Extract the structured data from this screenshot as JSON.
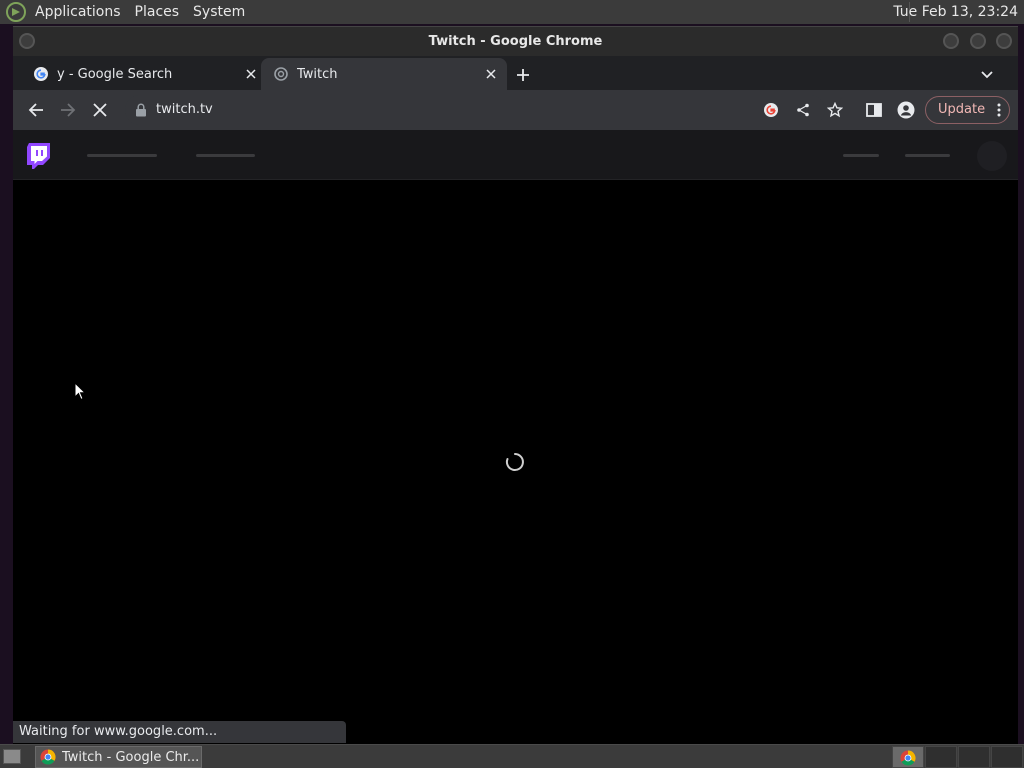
{
  "panel": {
    "menus": [
      "Applications",
      "Places",
      "System"
    ],
    "clock": "Tue Feb 13, 23:24"
  },
  "window": {
    "title": "Twitch - Google Chrome"
  },
  "tabs": [
    {
      "label": "y - Google Search",
      "active": false
    },
    {
      "label": "Twitch",
      "active": true
    }
  ],
  "toolbar": {
    "url": "twitch.tv",
    "update_label": "Update"
  },
  "status": {
    "text": "Waiting for www.google.com..."
  },
  "taskbar": {
    "task_label": "Twitch - Google Chr..."
  },
  "colors": {
    "twitch_purple": "#9147ff",
    "chrome_dark": "#202124",
    "toolbar": "#35363a",
    "update_accent": "#f2b8b5"
  }
}
